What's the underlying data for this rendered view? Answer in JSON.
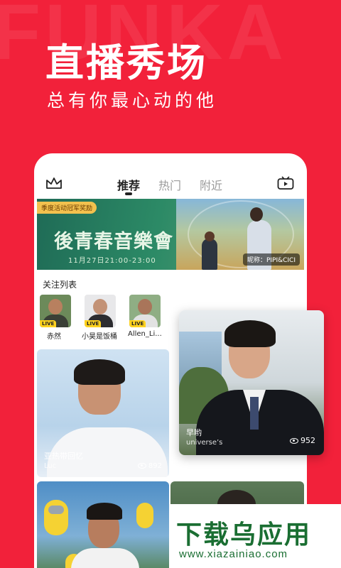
{
  "background_watermark": "FUNKA",
  "hero": {
    "title": "直播秀场",
    "subtitle": "总有你最心动的他"
  },
  "tabs": [
    {
      "label": "推荐",
      "active": true
    },
    {
      "label": "热门",
      "active": false
    },
    {
      "label": "附近",
      "active": false
    }
  ],
  "banner": {
    "tag": "季度活动冠军奖励",
    "title": "後青春音樂會",
    "date": "11月27日21:00-23:00",
    "nickname": "昵称：PIPI&CICI"
  },
  "follow": {
    "title": "关注列表",
    "items": [
      {
        "name": "赤然",
        "badge": "LIVE"
      },
      {
        "name": "小昊是饭桶",
        "badge": "LIVE"
      },
      {
        "name": "Allen_Li...",
        "badge": "LIVE"
      }
    ]
  },
  "cards": [
    {
      "title": "亚热带回忆",
      "subtitle": "Luc",
      "views": "892"
    },
    {
      "title": "",
      "subtitle": "",
      "views": ""
    },
    {
      "title": "",
      "subtitle": "",
      "views": ""
    }
  ],
  "featured": {
    "title": "早哟",
    "subtitle": "universe’s",
    "views": "952"
  },
  "site_watermark": {
    "main": "下载乌应用",
    "url": "www.xiazainiao.com"
  },
  "colors": {
    "primary": "#f2213a",
    "live_badge": "#ffd21f",
    "watermark_green": "#1a6e32"
  }
}
